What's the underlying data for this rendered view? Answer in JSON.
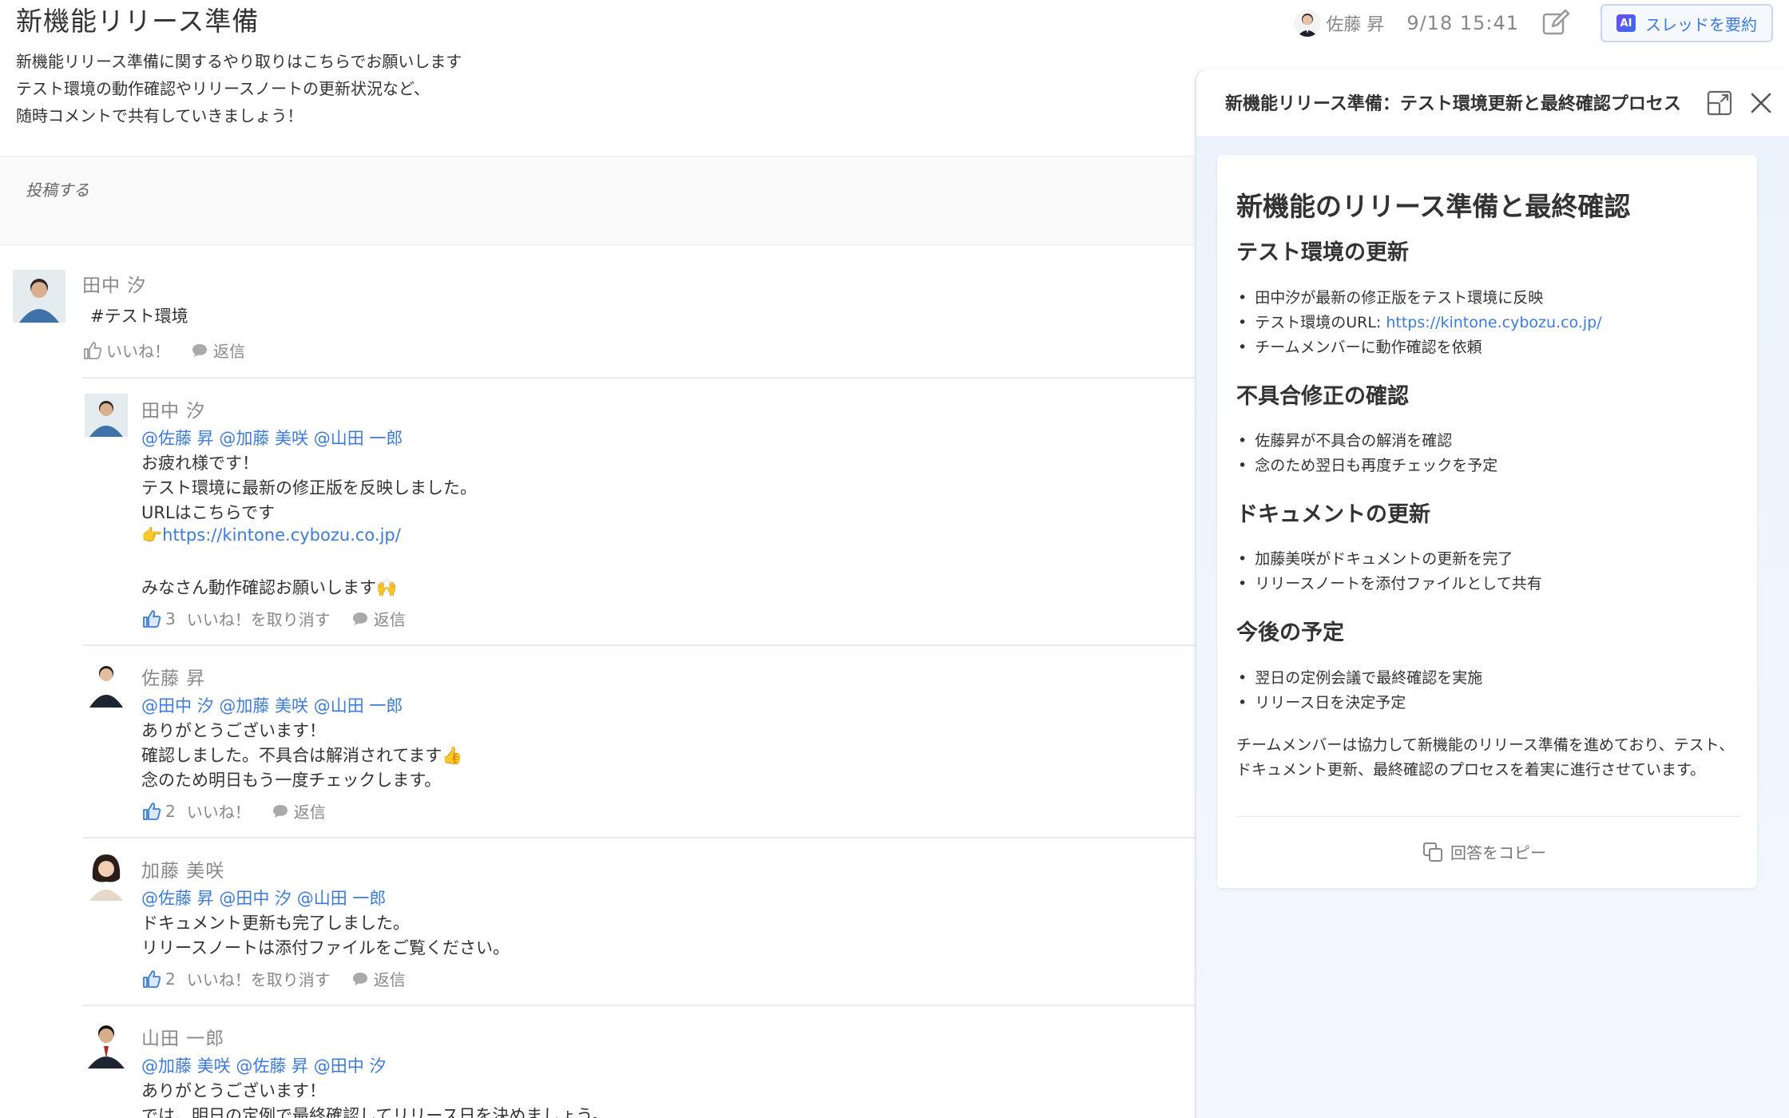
{
  "header": {
    "title": "新機能リリース準備",
    "description": [
      "新機能リリース準備に関するやり取りはこちらでお願いします",
      "テスト環境の動作確認やリリースノートの更新状況など、",
      "随時コメントで共有していきましょう！"
    ],
    "author": "佐藤 昇",
    "timestamp": "9/18 15:41",
    "ai_badge": "AI",
    "summarize_label": "スレッドを要約"
  },
  "composer": {
    "placeholder": "投稿する"
  },
  "comments": [
    {
      "author": "田中 汐",
      "body": "#テスト環境",
      "like_label": "いいね！",
      "reply_label": "返信"
    },
    {
      "author": "田中 汐",
      "mentions": "@佐藤 昇 @加藤 美咲 @山田 一郎",
      "lines": [
        "お疲れ様です！",
        "テスト環境に最新の修正版を反映しました。",
        "URLはこちらです"
      ],
      "link": "👉https://kintone.cybozu.co.jp/",
      "closing": "みなさん動作確認お願いします🙌",
      "like_count": "3",
      "like_label": "いいね！を取り消す",
      "reply_label": "返信"
    },
    {
      "author": "佐藤 昇",
      "mentions": "@田中 汐 @加藤 美咲 @山田 一郎",
      "lines": [
        "ありがとうございます！",
        "確認しました。不具合は解消されてます👍",
        "念のため明日もう一度チェックします。"
      ],
      "like_count": "2",
      "like_label": "いいね！",
      "reply_label": "返信"
    },
    {
      "author": "加藤 美咲",
      "mentions": "@佐藤 昇 @田中 汐 @山田 一郎",
      "lines": [
        "ドキュメント更新も完了しました。",
        "リリースノートは添付ファイルをご覧ください。"
      ],
      "like_count": "2",
      "like_label": "いいね！を取り消す",
      "reply_label": "返信"
    },
    {
      "author": "山田 一郎",
      "mentions": "@加藤 美咲 @佐藤 昇 @田中 汐",
      "lines": [
        "ありがとうございます！",
        "では、明日の定例で最終確認してリリース日を決めましょう。"
      ]
    }
  ],
  "side_panel": {
    "title": "新機能リリース準備：テスト環境更新と最終確認プロセス",
    "heading": "新機能のリリース準備と最終確認",
    "sections": [
      {
        "title": "テスト環境の更新",
        "items": [
          "田中汐が最新の修正版をテスト環境に反映",
          "テスト環境のURL: ",
          "チームメンバーに動作確認を依頼"
        ],
        "url": "https://kintone.cybozu.co.jp/"
      },
      {
        "title": "不具合修正の確認",
        "items": [
          "佐藤昇が不具合の解消を確認",
          "念のため翌日も再度チェックを予定"
        ]
      },
      {
        "title": "ドキュメントの更新",
        "items": [
          "加藤美咲がドキュメントの更新を完了",
          "リリースノートを添付ファイルとして共有"
        ]
      },
      {
        "title": "今後の予定",
        "items": [
          "翌日の定例会議で最終確認を実施",
          "リリース日を決定予定"
        ]
      }
    ],
    "conclusion": "チームメンバーは協力して新機能のリリース準備を進めており、テスト、ドキュメント更新、最終確認のプロセスを着実に進行させています。",
    "copy_label": "回答をコピー"
  },
  "colors": {
    "accent": "#3d7bd8",
    "muted_text": "#888888",
    "panel_bg": "#eaf3fc"
  },
  "icons": [
    "edit-icon",
    "ai-icon",
    "expand-icon",
    "close-icon",
    "thumbs-up-icon",
    "reply-bubble-icon",
    "copy-icon"
  ]
}
